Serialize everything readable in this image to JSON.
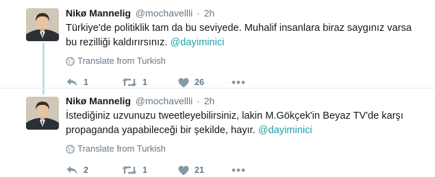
{
  "tweets": [
    {
      "name": "Nikø Mannelig",
      "handle": "@mochavellli",
      "separator": "·",
      "time": "2h",
      "text_pre": "Türkiye'de politiklik tam da bu seviyede. Muhalif insanlara biraz saygınız varsa bu rezilliği kaldırırsınız. ",
      "mention": "@dayiminici",
      "translate": "Translate from Turkish",
      "replies": "1",
      "retweets": "1",
      "likes": "26"
    },
    {
      "name": "Nikø Mannelig",
      "handle": "@mochavellli",
      "separator": "·",
      "time": "2h",
      "text_pre": "İstediğiniz uzvunuzu tweetleyebilirsiniz, lakin M.Gökçek'in Beyaz TV'de karşı propaganda yapabileceği bir şekilde, hayır. ",
      "mention": "@dayiminici",
      "translate": "Translate from Turkish",
      "replies": "2",
      "retweets": "1",
      "likes": "21"
    }
  ],
  "icons": {
    "avatar": "avatar-photo",
    "translate": "globe-icon",
    "reply": "reply-icon",
    "retweet": "retweet-icon",
    "like": "heart-icon",
    "more": "more-icon"
  },
  "colors": {
    "mention": "#1da1a8",
    "thread_line": "#b7e3e3",
    "muted": "#657786"
  }
}
